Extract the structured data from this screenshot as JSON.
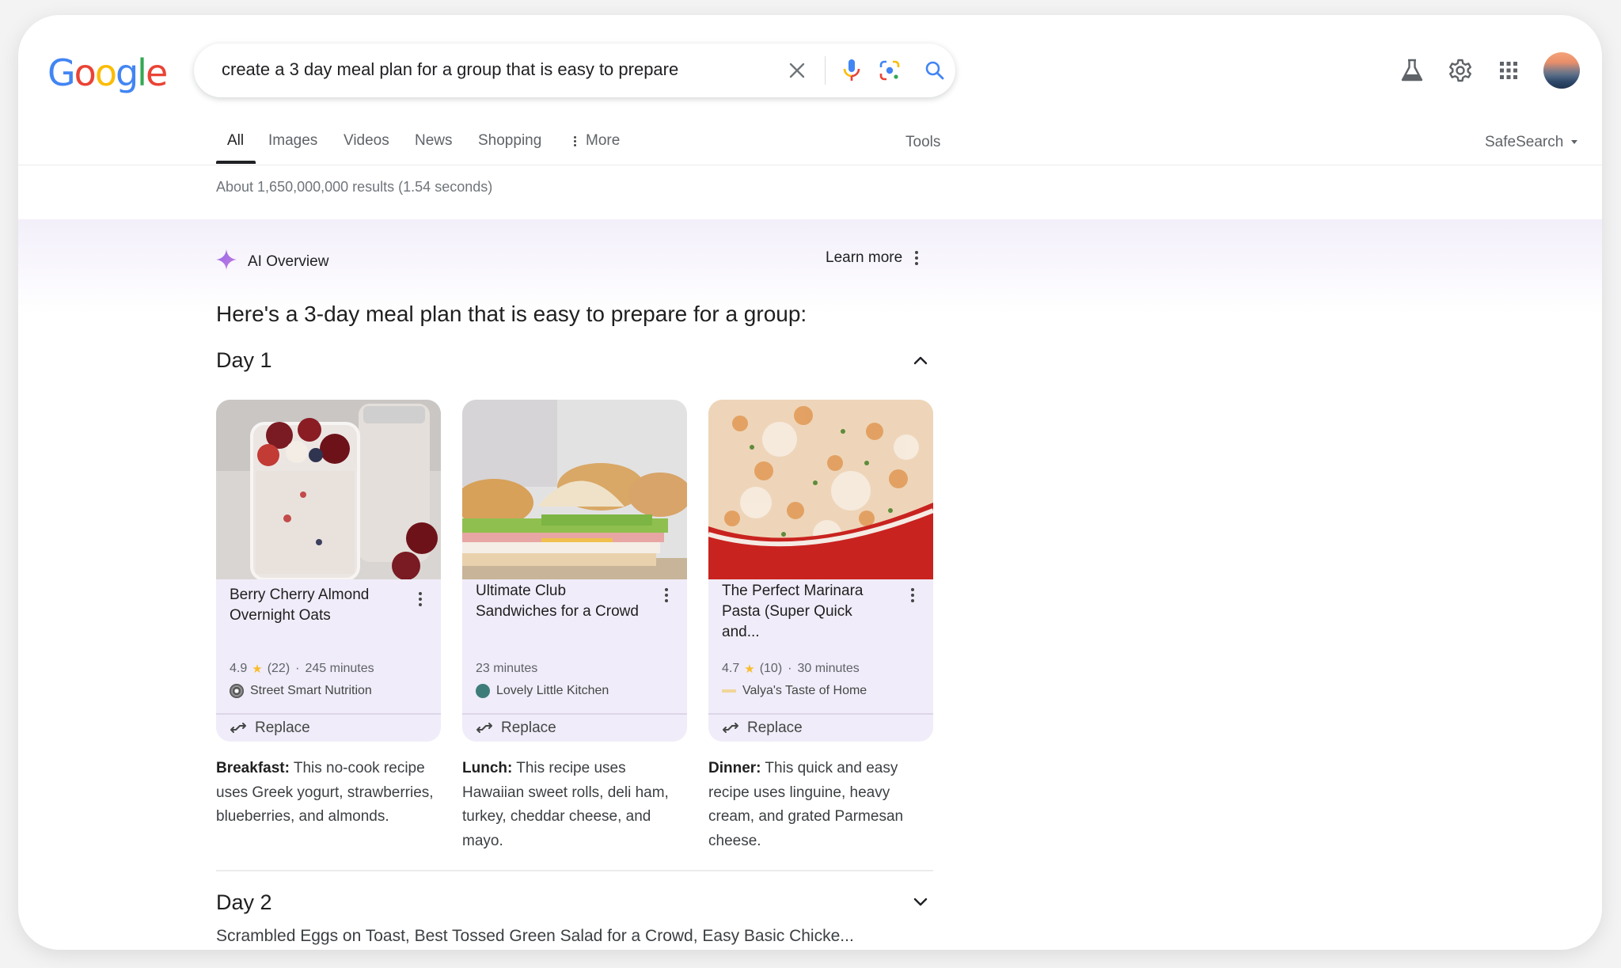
{
  "logo": {
    "letters": [
      {
        "char": "G",
        "color": "#4285f4"
      },
      {
        "char": "o",
        "color": "#ea4335"
      },
      {
        "char": "o",
        "color": "#fbbc05"
      },
      {
        "char": "g",
        "color": "#4285f4"
      },
      {
        "char": "l",
        "color": "#34a853"
      },
      {
        "char": "e",
        "color": "#ea4335"
      }
    ]
  },
  "search": {
    "query": "create a 3 day meal plan for a group that is easy to prepare",
    "icons": [
      "clear-icon",
      "microphone-icon",
      "google-lens-icon",
      "search-icon"
    ]
  },
  "header_icons": [
    "labs-flask-icon",
    "settings-gear-icon",
    "apps-grid-icon",
    "account-avatar"
  ],
  "tabs": {
    "items": [
      {
        "label": "All",
        "active": true
      },
      {
        "label": "Images",
        "active": false
      },
      {
        "label": "Videos",
        "active": false
      },
      {
        "label": "News",
        "active": false
      },
      {
        "label": "Shopping",
        "active": false
      },
      {
        "label": "More",
        "active": false
      }
    ],
    "tools": "Tools",
    "safesearch": "SafeSearch"
  },
  "stats": "About 1,650,000,000 results (1.54 seconds)",
  "ai_overview": {
    "label": "AI Overview",
    "learn_more": "Learn more",
    "heading": "Here's a 3-day meal plan that is easy to prepare for a group:",
    "days": [
      {
        "title": "Day 1",
        "expanded": true,
        "meals": [
          {
            "title": "Berry Cherry Almond Overnight Oats",
            "rating": "4.9",
            "reviews": "(22)",
            "time": "245 minutes",
            "source": "Street Smart Nutrition",
            "replace": "Replace",
            "desc_label": "Breakfast:",
            "desc_text": " This no-cook recipe uses Greek yogurt, strawberries, blueberries, and almonds."
          },
          {
            "title": "Ultimate Club Sandwiches for a Crowd",
            "rating": null,
            "reviews": null,
            "time": "23 minutes",
            "source": "Lovely Little Kitchen",
            "replace": "Replace",
            "desc_label": "Lunch:",
            "desc_text": " This recipe uses Hawaiian sweet rolls, deli ham, turkey, cheddar cheese, and mayo."
          },
          {
            "title": "The Perfect Marinara Pasta (Super Quick and...",
            "rating": "4.7",
            "reviews": "(10)",
            "time": "30 minutes",
            "source": "Valya's Taste of Home",
            "replace": "Replace",
            "desc_label": "Dinner:",
            "desc_text": " This quick and easy recipe uses linguine, heavy cream, and grated Parmesan cheese."
          }
        ]
      },
      {
        "title": "Day 2",
        "expanded": false,
        "summary": "Scrambled Eggs on Toast, Best Tossed Green Salad for a Crowd, Easy Basic Chicke..."
      }
    ]
  }
}
